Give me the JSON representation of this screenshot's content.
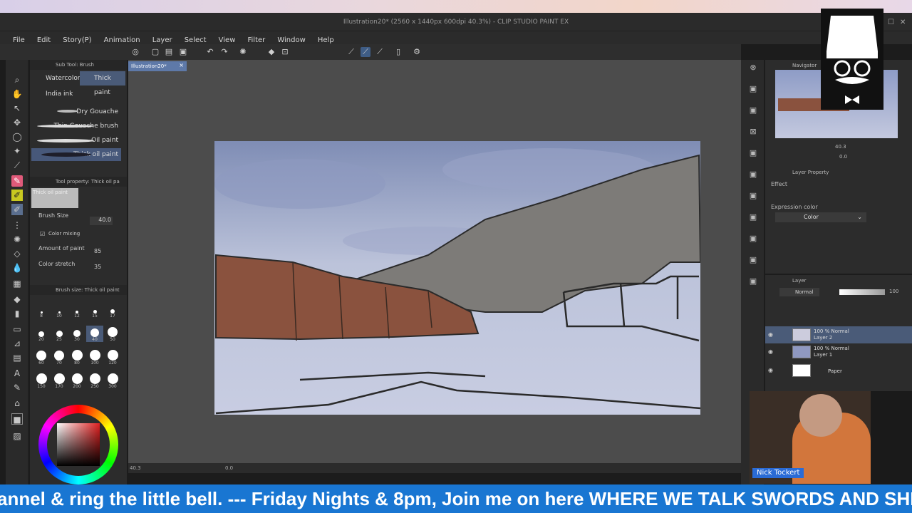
{
  "window": {
    "title": "Illustration20* (2560 x 1440px 600dpi 40.3%) - CLIP STUDIO PAINT EX"
  },
  "menu": [
    "File",
    "Edit",
    "Story(P)",
    "Animation",
    "Layer",
    "Select",
    "View",
    "Filter",
    "Window",
    "Help"
  ],
  "document_tab": {
    "label": "Illustration20*"
  },
  "sub_tool": {
    "header": "Sub Tool: Brush",
    "tabs": [
      "Watercolor",
      "Thick paint",
      "India ink"
    ],
    "brushes": [
      "Dry Gouache",
      "Thin Gouache brush",
      "Oil paint",
      "Thick oil paint"
    ]
  },
  "tool_property": {
    "header": "Tool property: Thick oil pa",
    "preview_label": "Thick oil paint",
    "brush_size_label": "Brush Size",
    "brush_size_value": "40.0",
    "color_mixing_label": "Color mixing",
    "amount_label": "Amount of paint",
    "amount_value": "85",
    "stretch_label": "Color stretch",
    "stretch_value": "35"
  },
  "brush_size_panel": {
    "header": "Brush size: Thick oil paint",
    "sizes": [
      "8",
      "10",
      "12",
      "15",
      "17",
      "20",
      "25",
      "30",
      "40",
      "50",
      "60",
      "70",
      "80",
      "100",
      "120",
      "150",
      "170",
      "200",
      "250",
      "300"
    ]
  },
  "navigator": {
    "header": "Navigator",
    "zoom": "40.3",
    "rotation": "0.0"
  },
  "layer_property": {
    "header": "Layer Property",
    "effect_label": "Effect",
    "expression_label": "Expression color",
    "expression_value": "Color"
  },
  "layers": {
    "header": "Layer",
    "blend_mode": "Normal",
    "opacity": "100",
    "items": [
      {
        "mode": "100 % Normal",
        "name": "Layer 2"
      },
      {
        "mode": "100 % Normal",
        "name": "Layer 1"
      },
      {
        "mode": "",
        "name": "Paper"
      }
    ]
  },
  "status": {
    "zoom": "40.3",
    "angle": "0.0"
  },
  "webcam": {
    "name": "Nick Tockert"
  },
  "ticker": {
    "text": "annel & ring the little bell. --- Friday Nights & 8pm, Join me on here WHERE WE TALK SWORDS AND SHENA"
  },
  "colors": {
    "accent": "#4a5b78",
    "ticker": "#1976d2",
    "active_tool": "#e05a7a"
  }
}
